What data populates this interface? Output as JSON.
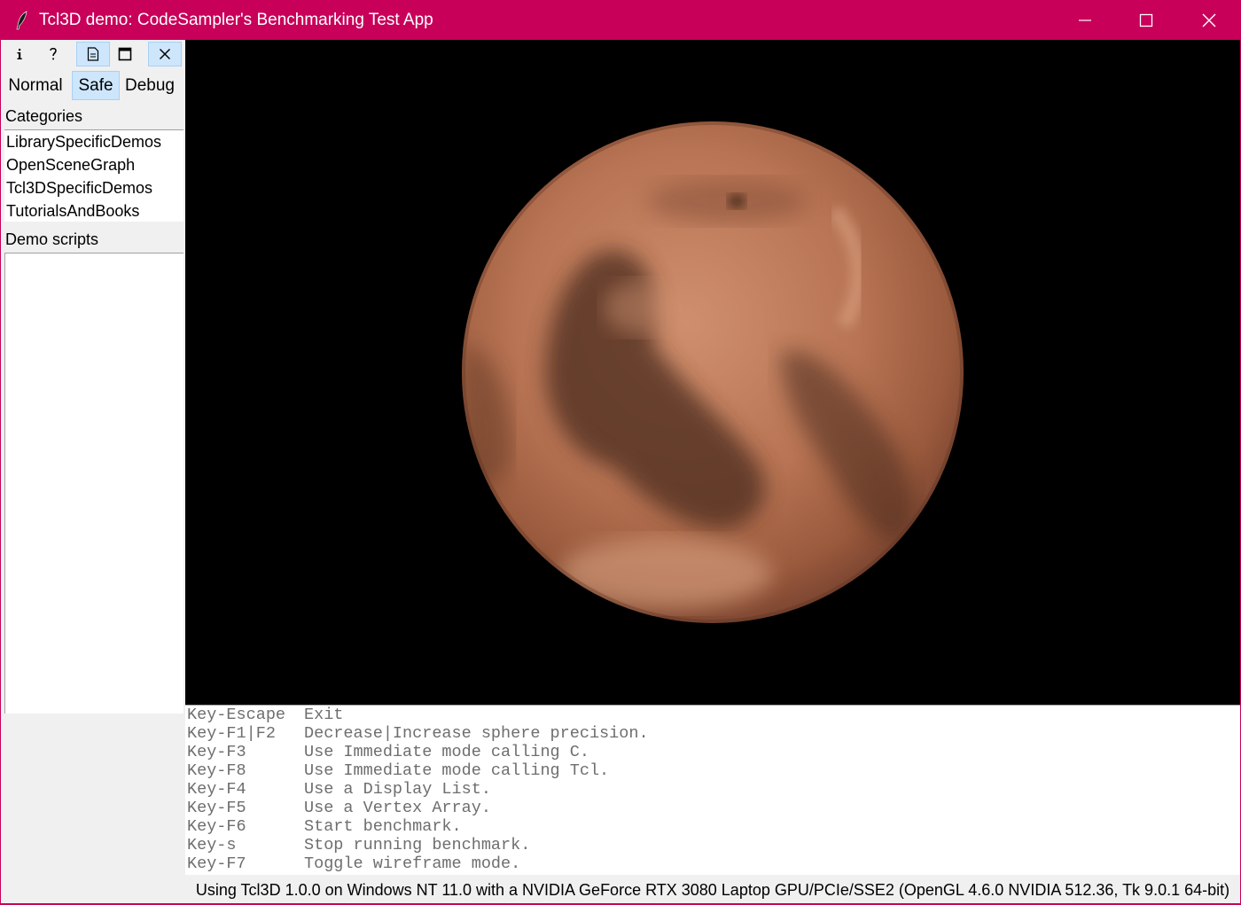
{
  "window": {
    "title": "Tcl3D demo: CodeSampler's Benchmarking Test App",
    "accent": "#c8005a"
  },
  "toolbar": {
    "buttons": [
      {
        "name": "info-icon",
        "glyph": "i",
        "pressed": false
      },
      {
        "name": "help-icon",
        "glyph": "?",
        "pressed": false
      },
      {
        "name": "document-icon",
        "glyph": "document",
        "pressed": true
      },
      {
        "name": "maximize-canvas-icon",
        "glyph": "window",
        "pressed": false
      },
      {
        "name": "close-icon",
        "glyph": "x",
        "pressed": true
      }
    ]
  },
  "modes": [
    {
      "label": "Normal",
      "selected": false
    },
    {
      "label": "Safe",
      "selected": true
    },
    {
      "label": "Debug",
      "selected": false
    }
  ],
  "categories": {
    "label": "Categories",
    "items": [
      "LibrarySpecificDemos",
      "OpenSceneGraph",
      "Tcl3DSpecificDemos",
      "TutorialsAndBooks"
    ]
  },
  "demo_scripts": {
    "label": "Demo scripts",
    "items": []
  },
  "console": {
    "lines": [
      {
        "key": "Key-Escape",
        "desc": "Exit"
      },
      {
        "key": "Key-F1|F2",
        "desc": "Decrease|Increase sphere precision."
      },
      {
        "key": "Key-F3",
        "desc": "Use Immediate mode calling C."
      },
      {
        "key": "Key-F8",
        "desc": "Use Immediate mode calling Tcl."
      },
      {
        "key": "Key-F4",
        "desc": "Use a Display List."
      },
      {
        "key": "Key-F5",
        "desc": "Use a Vertex Array."
      },
      {
        "key": "Key-F6",
        "desc": "Start benchmark."
      },
      {
        "key": "Key-s",
        "desc": "Stop running benchmark."
      },
      {
        "key": "Key-F7",
        "desc": "Toggle wireframe mode."
      }
    ]
  },
  "status": "Using Tcl3D 1.0.0 on Windows NT 11.0 with a NVIDIA GeForce RTX 3080 Laptop GPU/PCIe/SSE2 (OpenGL 4.6.0 NVIDIA 512.36, Tk 9.0.1 64-bit)"
}
